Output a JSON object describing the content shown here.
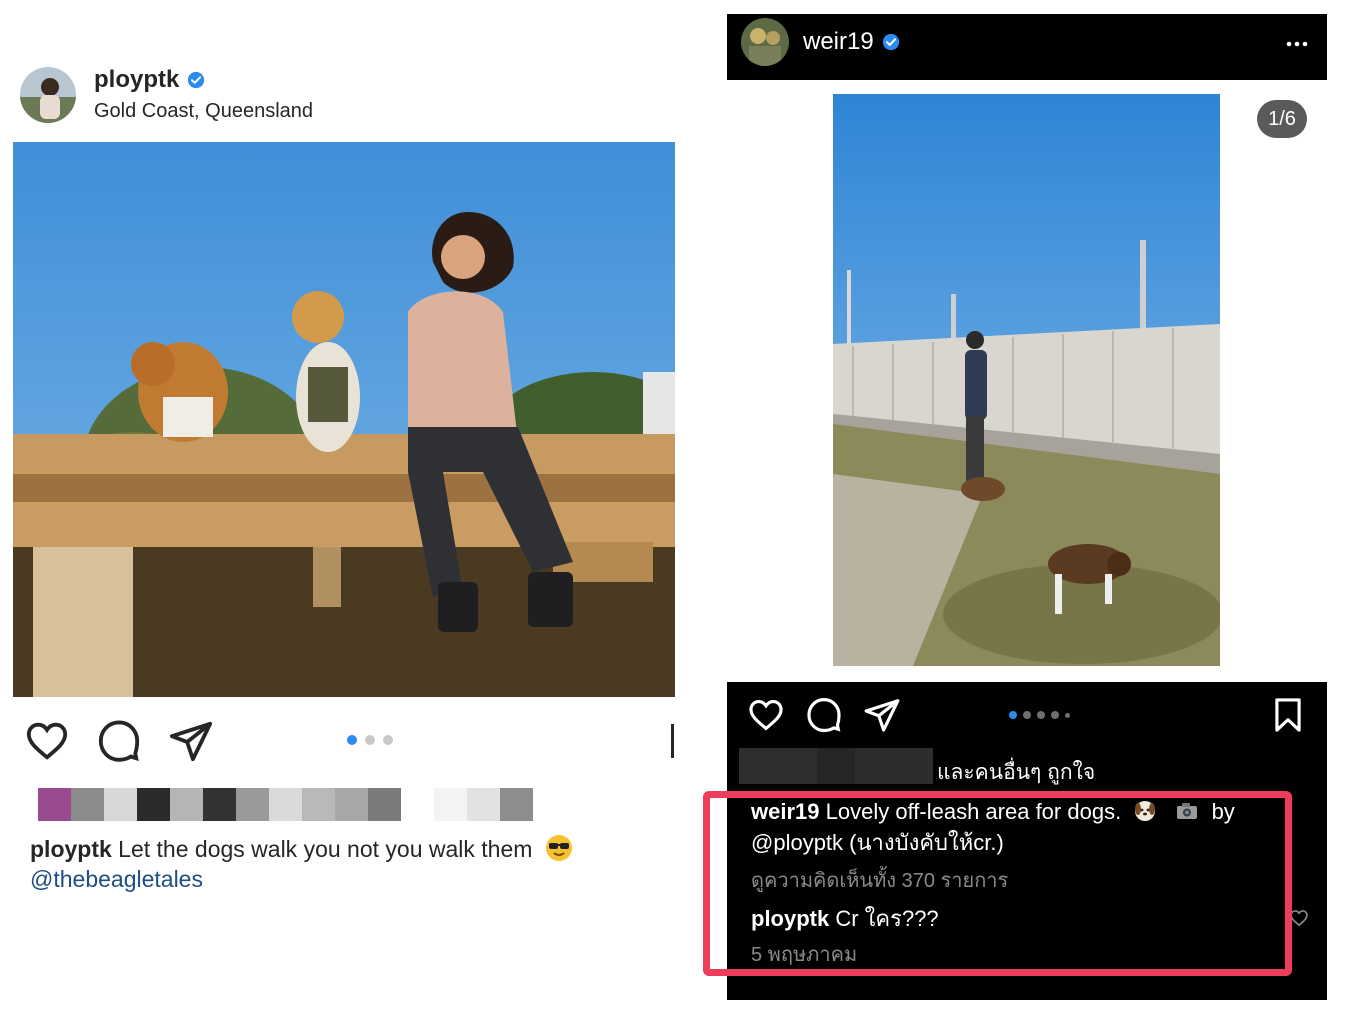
{
  "left_post": {
    "username": "ployptk",
    "location": "Gold Coast, Queensland",
    "verified_icon": "verified-badge-icon",
    "carousel": {
      "count": 3,
      "active": 0
    },
    "caption": {
      "username": "ployptk",
      "text": "Let the dogs walk you not you walk them",
      "mention": "@thebeagletales"
    },
    "icons": [
      "heart-icon",
      "comment-icon",
      "share-icon"
    ]
  },
  "right_post": {
    "username": "weir19",
    "counter": "1/6",
    "liked_text": "และคนอื่นๆ ถูกใจ",
    "caption": {
      "username": "weir19",
      "text_a": "Lovely off-leash area for dogs.",
      "text_b": "by",
      "line2": "@ployptk (นางบังคับให้cr.)"
    },
    "view_comments": "ดูความคิดเห็นทั้ง 370 รายการ",
    "reply": {
      "username": "ployptk",
      "text": "Cr ใคร???"
    },
    "date": "5 พฤษภาคม",
    "carousel": {
      "count": 6,
      "active": 0
    },
    "icons": [
      "heart-icon",
      "comment-icon",
      "share-icon",
      "bookmark-icon",
      "more-icon"
    ]
  },
  "colors": {
    "accent_blue": "#2b8cf0",
    "highlight_red": "#ee3d5a",
    "dark_bg": "#000000"
  }
}
